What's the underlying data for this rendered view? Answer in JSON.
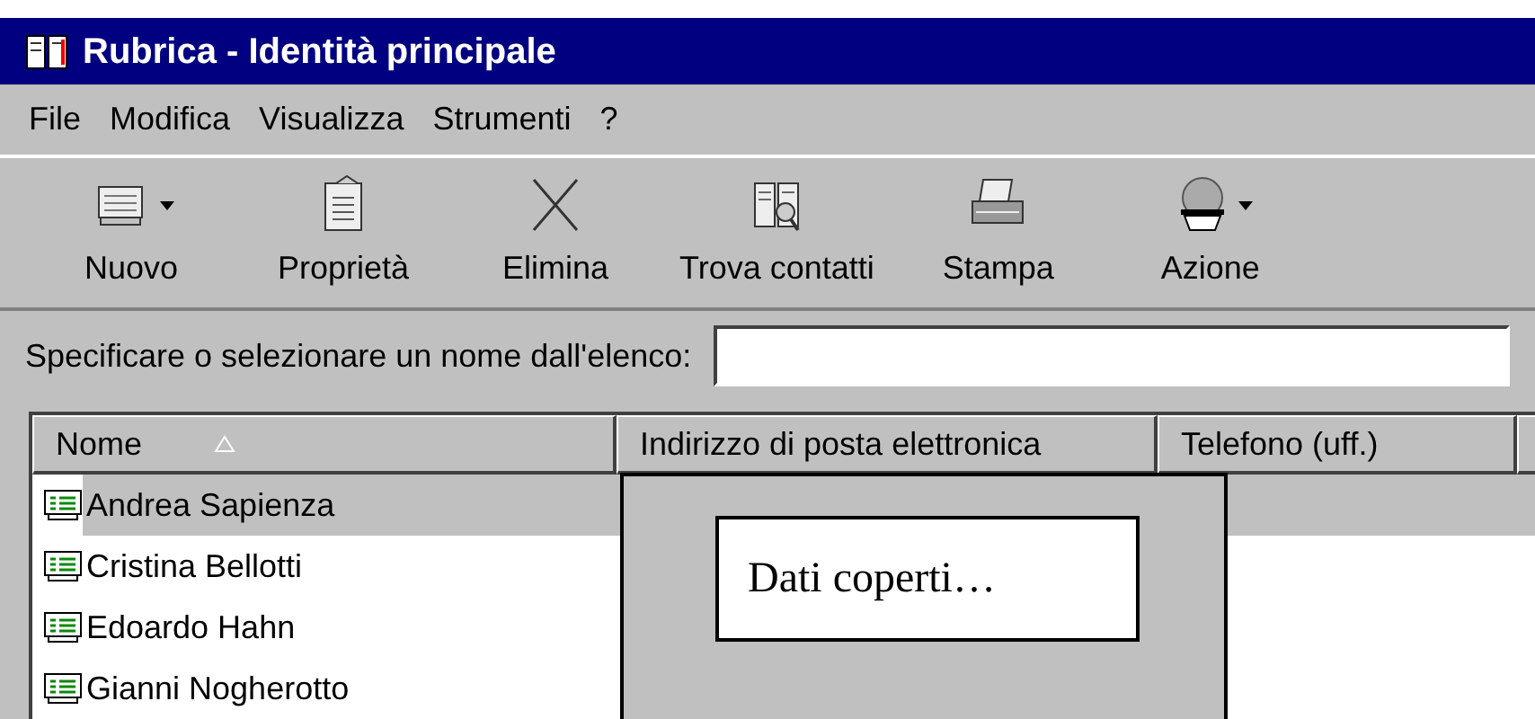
{
  "window": {
    "title": "Rubrica - Identità principale"
  },
  "menu": [
    "File",
    "Modifica",
    "Visualizza",
    "Strumenti",
    "?"
  ],
  "toolbar": [
    {
      "label": "Nuovo",
      "dropdown": true
    },
    {
      "label": "Proprietà",
      "dropdown": false
    },
    {
      "label": "Elimina",
      "dropdown": false
    },
    {
      "label": "Trova contatti",
      "dropdown": false
    },
    {
      "label": "Stampa",
      "dropdown": false
    },
    {
      "label": "Azione",
      "dropdown": true
    }
  ],
  "search": {
    "label": "Specificare o selezionare un nome dall'elenco:"
  },
  "table": {
    "columns": [
      {
        "label": "Nome",
        "sorted": true
      },
      {
        "label": "Indirizzo di posta elettronica",
        "sorted": false
      },
      {
        "label": "Telefono (uff.)",
        "sorted": false
      }
    ],
    "rows": [
      {
        "name": "Andrea Sapienza",
        "selected": true
      },
      {
        "name": "Cristina Bellotti",
        "selected": false
      },
      {
        "name": "Edoardo Hahn",
        "selected": false
      },
      {
        "name": "Gianni Nogherotto",
        "selected": false
      }
    ]
  },
  "overlay": {
    "text": "Dati coperti…"
  }
}
